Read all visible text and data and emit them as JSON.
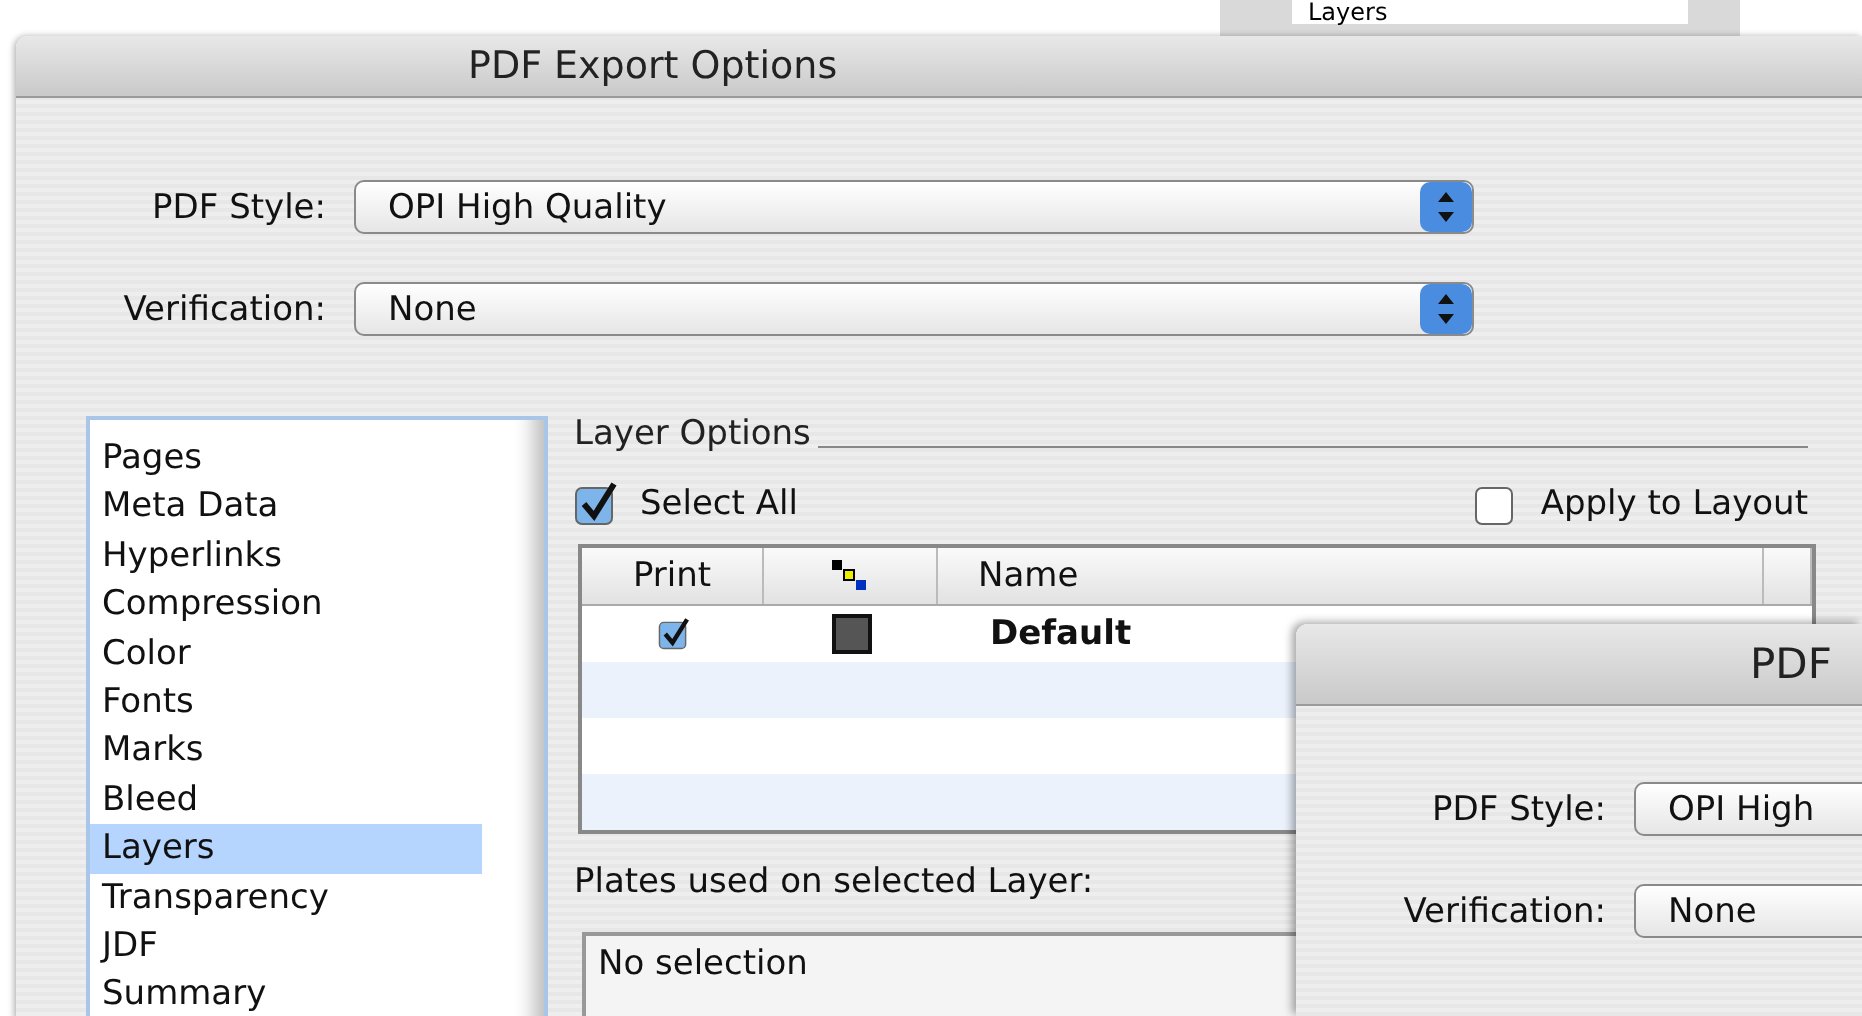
{
  "background_window": {
    "list_item": "Layers"
  },
  "dialog": {
    "title": "PDF Export Options",
    "fields": [
      {
        "label": "PDF Style:",
        "value": "OPI High Quality"
      },
      {
        "label": "Verification:",
        "value": "None"
      }
    ],
    "sections": [
      {
        "label": "Pages",
        "selected": false
      },
      {
        "label": "Meta Data",
        "selected": false
      },
      {
        "label": "Hyperlinks",
        "selected": false
      },
      {
        "label": "Compression",
        "selected": false
      },
      {
        "label": "Color",
        "selected": false
      },
      {
        "label": "Fonts",
        "selected": false
      },
      {
        "label": "Marks",
        "selected": false
      },
      {
        "label": "Bleed",
        "selected": false
      },
      {
        "label": "Layers",
        "selected": true
      },
      {
        "label": "Transparency",
        "selected": false
      },
      {
        "label": "JDF",
        "selected": false
      },
      {
        "label": "Summary",
        "selected": false
      }
    ],
    "layer_options": {
      "title": "Layer Options",
      "select_all": {
        "label": "Select All",
        "checked": true
      },
      "apply_to_layout": {
        "label": "Apply to Layout",
        "checked": false
      },
      "table": {
        "columns": [
          {
            "kind": "text",
            "label": "Print"
          },
          {
            "kind": "icon"
          },
          {
            "kind": "text",
            "label": "Name"
          }
        ],
        "rows": [
          {
            "print": true,
            "name": "Default"
          }
        ]
      },
      "plates_label": "Plates used on selected Layer:",
      "plates_value": "No selection"
    }
  },
  "overlay_dialog": {
    "title": "PDF",
    "fields": [
      {
        "label": "PDF Style:",
        "value": "OPI High"
      },
      {
        "label": "Verification:",
        "value": "None"
      }
    ]
  }
}
